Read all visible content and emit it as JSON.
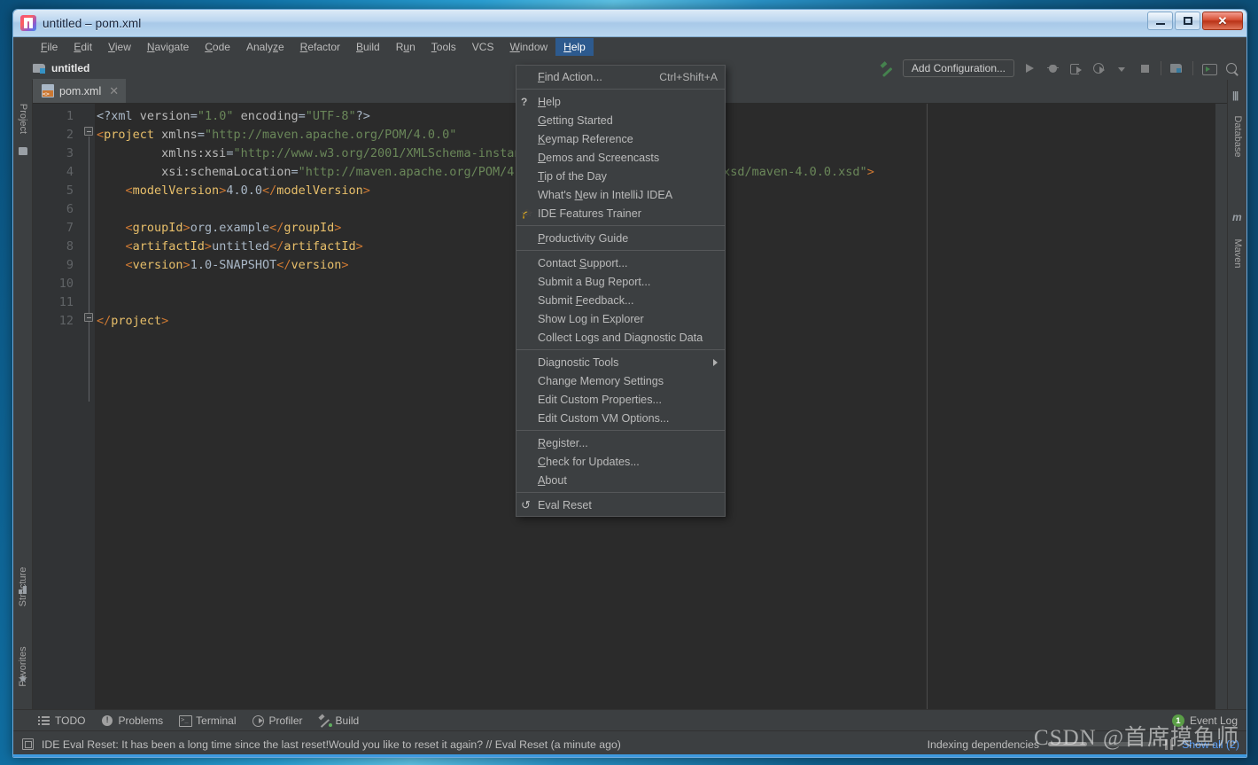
{
  "window": {
    "title": "untitled – pom.xml",
    "app_icon": "intellij-idea-icon",
    "minimize": "–",
    "maximize": "□",
    "close": "✕"
  },
  "menubar": [
    {
      "label": "File",
      "mnemonic": "F"
    },
    {
      "label": "Edit",
      "mnemonic": "E"
    },
    {
      "label": "View",
      "mnemonic": "V"
    },
    {
      "label": "Navigate",
      "mnemonic": "N"
    },
    {
      "label": "Code",
      "mnemonic": "C"
    },
    {
      "label": "Analyze",
      "mnemonic": "z"
    },
    {
      "label": "Refactor",
      "mnemonic": "R"
    },
    {
      "label": "Build",
      "mnemonic": "B"
    },
    {
      "label": "Run",
      "mnemonic": "u"
    },
    {
      "label": "Tools",
      "mnemonic": "T"
    },
    {
      "label": "VCS",
      "mnemonic": ""
    },
    {
      "label": "Window",
      "mnemonic": "W"
    },
    {
      "label": "Help",
      "mnemonic": "H",
      "active": true
    }
  ],
  "breadcrumb": {
    "project_name": "untitled"
  },
  "toolbar": {
    "build_icon": "hammer-icon",
    "add_configuration": "Add Configuration...",
    "run_icon": "run-icon",
    "debug_icon": "debug-bug-icon",
    "run_with_coverage_icon": "run-with-coverage-icon",
    "profile_icon": "profiler-icon",
    "dropdown_icon": "chevron-down-icon",
    "stop_icon": "stop-icon",
    "project_structure_icon": "project-structure-icon",
    "terminal_icon": "terminal-icon",
    "search_everywhere_icon": "search-icon"
  },
  "left_stripe": [
    {
      "label": "Project",
      "icon": "folder-icon"
    },
    {
      "label": "Structure",
      "icon": "structure-icon"
    },
    {
      "label": "Favorites",
      "icon": "star-icon"
    }
  ],
  "right_stripe": [
    {
      "label": "Database",
      "icon": "database-icon"
    },
    {
      "label": "Maven",
      "icon": "maven-m-icon"
    }
  ],
  "editor": {
    "tab": {
      "filename": "pom.xml",
      "icon": "xml-file-icon",
      "close": "✕"
    },
    "line_numbers": [
      "1",
      "2",
      "3",
      "4",
      "5",
      "6",
      "7",
      "8",
      "9",
      "10",
      "11",
      "12"
    ],
    "code_lines": [
      {
        "n": 1,
        "segments": [
          {
            "t": "<?xml ",
            "c": "proc"
          },
          {
            "t": "version",
            "c": "attr"
          },
          {
            "t": "=",
            "c": "txt"
          },
          {
            "t": "\"1.0\"",
            "c": "str"
          },
          {
            "t": " encoding",
            "c": "attr"
          },
          {
            "t": "=",
            "c": "txt"
          },
          {
            "t": "\"UTF-8\"",
            "c": "str"
          },
          {
            "t": "?>",
            "c": "proc"
          }
        ]
      },
      {
        "n": 2,
        "segments": [
          {
            "t": "<",
            "c": "brack"
          },
          {
            "t": "project",
            "c": "tagname"
          },
          {
            "t": " xmlns",
            "c": "attr"
          },
          {
            "t": "=",
            "c": "txt"
          },
          {
            "t": "\"http://maven.apache.org/POM/4.0.0\"",
            "c": "str"
          }
        ]
      },
      {
        "n": 3,
        "segments": [
          {
            "t": "         xmlns:xsi",
            "c": "attr"
          },
          {
            "t": "=",
            "c": "txt"
          },
          {
            "t": "\"http://www.w3.org/2001/XMLSchema-instance\"",
            "c": "str"
          }
        ]
      },
      {
        "n": 4,
        "segments": [
          {
            "t": "         xsi:schemaLocation",
            "c": "attr"
          },
          {
            "t": "=",
            "c": "txt"
          },
          {
            "t": "\"http://maven.apache.org/POM/4.0.0 http://maven.apache.org/xsd/maven-4.0.0.xsd\"",
            "c": "str"
          },
          {
            "t": ">",
            "c": "brack"
          }
        ]
      },
      {
        "n": 5,
        "segments": [
          {
            "t": "    <",
            "c": "brack"
          },
          {
            "t": "modelVersion",
            "c": "tagname"
          },
          {
            "t": ">",
            "c": "brack"
          },
          {
            "t": "4.0.0",
            "c": "txt"
          },
          {
            "t": "</",
            "c": "brack"
          },
          {
            "t": "modelVersion",
            "c": "tagname"
          },
          {
            "t": ">",
            "c": "brack"
          }
        ]
      },
      {
        "n": 6,
        "segments": []
      },
      {
        "n": 7,
        "segments": [
          {
            "t": "    <",
            "c": "brack"
          },
          {
            "t": "groupId",
            "c": "tagname"
          },
          {
            "t": ">",
            "c": "brack"
          },
          {
            "t": "org.example",
            "c": "txt"
          },
          {
            "t": "</",
            "c": "brack"
          },
          {
            "t": "groupId",
            "c": "tagname"
          },
          {
            "t": ">",
            "c": "brack"
          }
        ]
      },
      {
        "n": 8,
        "segments": [
          {
            "t": "    <",
            "c": "brack"
          },
          {
            "t": "artifactId",
            "c": "tagname"
          },
          {
            "t": ">",
            "c": "brack"
          },
          {
            "t": "untitled",
            "c": "txt"
          },
          {
            "t": "</",
            "c": "brack"
          },
          {
            "t": "artifactId",
            "c": "tagname"
          },
          {
            "t": ">",
            "c": "brack"
          }
        ]
      },
      {
        "n": 9,
        "segments": [
          {
            "t": "    <",
            "c": "brack"
          },
          {
            "t": "version",
            "c": "tagname"
          },
          {
            "t": ">",
            "c": "brack"
          },
          {
            "t": "1.0-SNAPSHOT",
            "c": "txt"
          },
          {
            "t": "</",
            "c": "brack"
          },
          {
            "t": "version",
            "c": "tagname"
          },
          {
            "t": ">",
            "c": "brack"
          }
        ]
      },
      {
        "n": 10,
        "segments": []
      },
      {
        "n": 11,
        "segments": []
      },
      {
        "n": 12,
        "segments": [
          {
            "t": "</",
            "c": "brack"
          },
          {
            "t": "project",
            "c": "tagname"
          },
          {
            "t": ">",
            "c": "brack"
          }
        ]
      }
    ]
  },
  "help_menu": {
    "groups": [
      [
        {
          "label": "Find Action...",
          "mnemonic": "F",
          "shortcut": "Ctrl+Shift+A"
        }
      ],
      [
        {
          "label": "Help",
          "mnemonic": "H",
          "icon": "question-mark-icon"
        },
        {
          "label": "Getting Started",
          "mnemonic": "G"
        },
        {
          "label": "Keymap Reference",
          "mnemonic": "K"
        },
        {
          "label": "Demos and Screencasts",
          "mnemonic": "D"
        },
        {
          "label": "Tip of the Day",
          "mnemonic": "T"
        },
        {
          "label": "What's New in IntelliJ IDEA",
          "mnemonic": "N"
        },
        {
          "label": "IDE Features Trainer",
          "icon": "graduation-cap-icon"
        }
      ],
      [
        {
          "label": "Productivity Guide",
          "mnemonic": "P"
        }
      ],
      [
        {
          "label": "Contact Support...",
          "mnemonic": "S"
        },
        {
          "label": "Submit a Bug Report..."
        },
        {
          "label": "Submit Feedback...",
          "mnemonic": "F"
        },
        {
          "label": "Show Log in Explorer"
        },
        {
          "label": "Collect Logs and Diagnostic Data"
        }
      ],
      [
        {
          "label": "Diagnostic Tools",
          "submenu": true
        },
        {
          "label": "Change Memory Settings"
        },
        {
          "label": "Edit Custom Properties..."
        },
        {
          "label": "Edit Custom VM Options..."
        }
      ],
      [
        {
          "label": "Register...",
          "mnemonic": "R"
        },
        {
          "label": "Check for Updates...",
          "mnemonic": "C"
        },
        {
          "label": "About",
          "mnemonic": "A"
        }
      ],
      [
        {
          "label": "Eval Reset",
          "icon": "reset-arrow-icon"
        }
      ]
    ]
  },
  "bottom_bar": {
    "items": [
      {
        "label": "TODO",
        "icon": "todo-list-icon"
      },
      {
        "label": "Problems",
        "icon": "problems-icon"
      },
      {
        "label": "Terminal",
        "icon": "terminal-icon"
      },
      {
        "label": "Profiler",
        "icon": "profiler-icon"
      },
      {
        "label": "Build",
        "icon": "build-hammer-icon"
      }
    ],
    "event_log": {
      "label": "Event Log",
      "count": "1"
    }
  },
  "status_bar": {
    "message_icon": "notification-balloon-icon",
    "message": "IDE Eval Reset: It has been a long time since the last reset!Would you like to reset it again? // Eval Reset (a minute ago)",
    "indexing_label": "Indexing dependencies",
    "progress_percent": 36,
    "pause_icon": "pause-icon",
    "show_all": "Show all (2)"
  },
  "watermark": "CSDN @首席摸鱼师"
}
